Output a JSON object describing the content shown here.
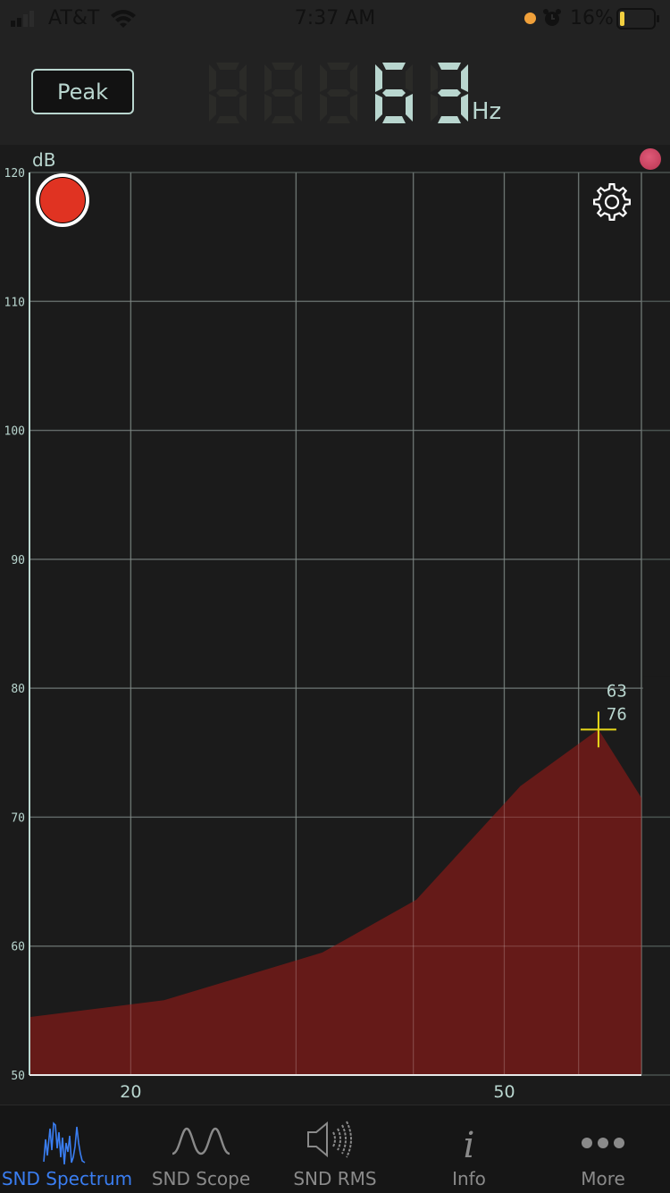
{
  "status_bar": {
    "carrier": "AT&T",
    "time": "7:37 AM",
    "battery_percent": "16%",
    "battery_level": 0.16,
    "icons": [
      "signal-icon",
      "wifi-icon",
      "orange-dot-icon",
      "alarm-icon",
      "battery-icon"
    ]
  },
  "header": {
    "mode_button": "Peak",
    "frequency_display": "63",
    "frequency_digits_total": 5,
    "unit": "Hz"
  },
  "chart_data": {
    "type": "area",
    "title": "",
    "ylabel": "dB",
    "xlabel": "",
    "x_scale": "log",
    "xlim": [
      15.6,
      70
    ],
    "ylim": [
      50,
      120
    ],
    "y_ticks": [
      50,
      60,
      70,
      80,
      90,
      100,
      110,
      120
    ],
    "x_gridlines": [
      20,
      30,
      40,
      50,
      60,
      70
    ],
    "x_tick_labels": [
      {
        "value": 20,
        "label": "20"
      },
      {
        "value": 50,
        "label": "50"
      }
    ],
    "grid": true,
    "series": [
      {
        "name": "spectrum",
        "color": "#6b1a18",
        "x": [
          15.6,
          21.7,
          32,
          40.3,
          52,
          63,
          70
        ],
        "y": [
          54.5,
          55.8,
          59.5,
          63.6,
          72.4,
          76.8,
          71.5
        ]
      }
    ],
    "peak_marker": {
      "x": 63,
      "y": 76.8,
      "label_freq": "63",
      "label_db": "76",
      "color": "#e8d81a"
    }
  },
  "controls": {
    "record_button_color": "#e03322",
    "indicator_color": "#c9485f"
  },
  "tabs": [
    {
      "label": "SND Spectrum",
      "icon": "spectrum-icon",
      "active": true
    },
    {
      "label": "SND Scope",
      "icon": "sine-wave-icon",
      "active": false
    },
    {
      "label": "SND RMS",
      "icon": "speaker-icon",
      "active": false
    },
    {
      "label": "Info",
      "icon": "info-icon",
      "active": false
    },
    {
      "label": "More",
      "icon": "more-icon",
      "active": false
    }
  ]
}
